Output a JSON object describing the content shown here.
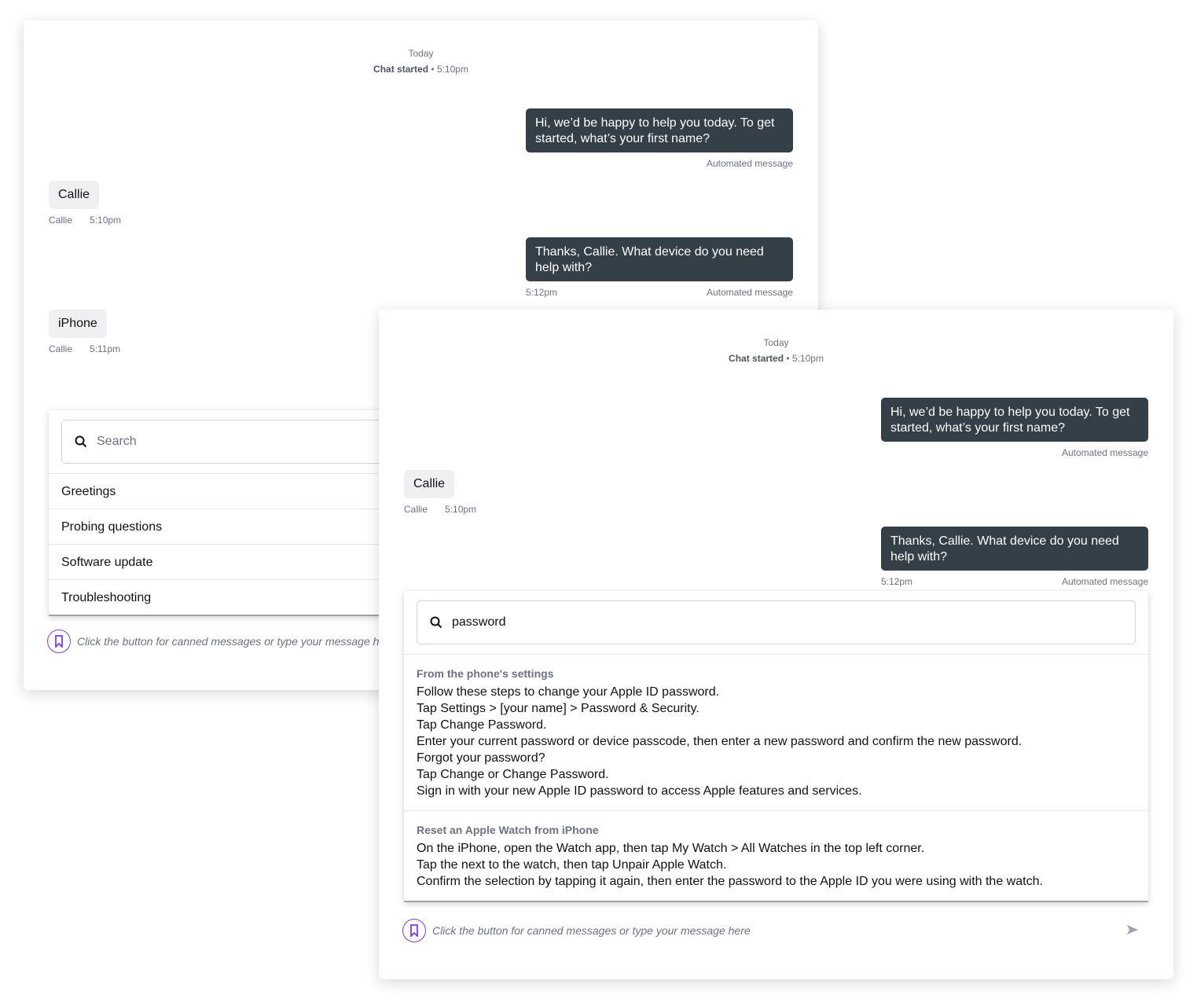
{
  "chat_header": {
    "day": "Today",
    "started_label": "Chat started",
    "started_time": "• 5:10pm"
  },
  "messages": [
    {
      "text": "Hi, we’d be happy to help you  today. To get started, what’s your first name?",
      "meta": "Automated message"
    },
    {
      "text": "Callie",
      "author": "Callie",
      "time": "5:10pm"
    },
    {
      "text": "Thanks, Callie. What device do you need help with?",
      "time": "5:12pm",
      "meta": "Automated message"
    },
    {
      "text": "iPhone",
      "author": "Callie",
      "time": "5:11pm"
    }
  ],
  "canned_panel": {
    "search_placeholder": "Search",
    "categories": [
      "Greetings",
      "Probing questions",
      "Software update",
      "Troubleshooting"
    ]
  },
  "search_panel": {
    "query": "password",
    "results": [
      {
        "title": "From the phone's settings",
        "lines": [
          "Follow these steps to change your Apple ID password.",
          "Tap Settings > [your name] > Password & Security.",
          "Tap Change Password.",
          "Enter your current password or device passcode, then enter a new password and confirm the new password.",
          "Forgot your password?",
          "Tap Change or Change Password.",
          "Sign in with your new Apple ID password to access Apple features and services."
        ]
      },
      {
        "title": "Reset an Apple Watch from iPhone",
        "lines": [
          "On the iPhone, open the Watch app, then tap My Watch > All Watches in the top left corner.",
          "Tap the next to the watch, then tap Unpair Apple Watch.",
          "Confirm the selection by tapping it again, then enter the password to the Apple ID you were using with the watch."
        ]
      }
    ]
  },
  "composer": {
    "placeholder": "Click the button for canned messages or type your message here"
  },
  "icons": {
    "canned": "bookmark-icon",
    "search": "search-icon",
    "send": "send-icon"
  },
  "colors": {
    "agent_bubble": "#343f48",
    "customer_bubble": "#f0f0f3",
    "accent": "#7c3aed"
  }
}
